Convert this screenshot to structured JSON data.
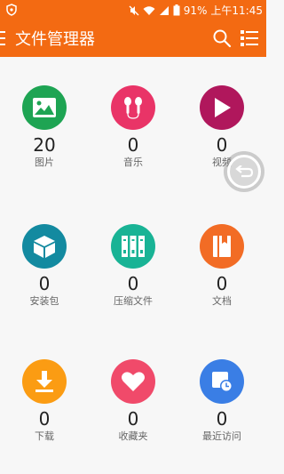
{
  "status_bar": {
    "battery": "91%",
    "time": "上午11:45"
  },
  "app_bar": {
    "title": "文件管理器",
    "menu_icon": "menu-icon",
    "search_icon": "search-icon",
    "list_icon": "list-view-icon"
  },
  "categories": [
    {
      "label": "图片",
      "count": "20",
      "color": "#1ea453",
      "icon": "image-icon"
    },
    {
      "label": "音乐",
      "count": "0",
      "color": "#e93467",
      "icon": "earphones-icon"
    },
    {
      "label": "视频",
      "count": "0",
      "color": "#b0175c",
      "icon": "play-icon"
    },
    {
      "label": "安装包",
      "count": "0",
      "color": "#138aa0",
      "icon": "package-cube-icon"
    },
    {
      "label": "压缩文件",
      "count": "0",
      "color": "#19b395",
      "icon": "archive-icon"
    },
    {
      "label": "文档",
      "count": "0",
      "color": "#f26c25",
      "icon": "document-icon"
    },
    {
      "label": "下载",
      "count": "0",
      "color": "#fb9c13",
      "icon": "download-icon"
    },
    {
      "label": "收藏夹",
      "count": "0",
      "color": "#f04a6a",
      "icon": "heart-icon"
    },
    {
      "label": "最近访问",
      "count": "0",
      "color": "#3a7ee5",
      "icon": "recent-clock-icon"
    }
  ],
  "colors": {
    "accent": "#f36a12",
    "background": "#f7f7f7"
  }
}
